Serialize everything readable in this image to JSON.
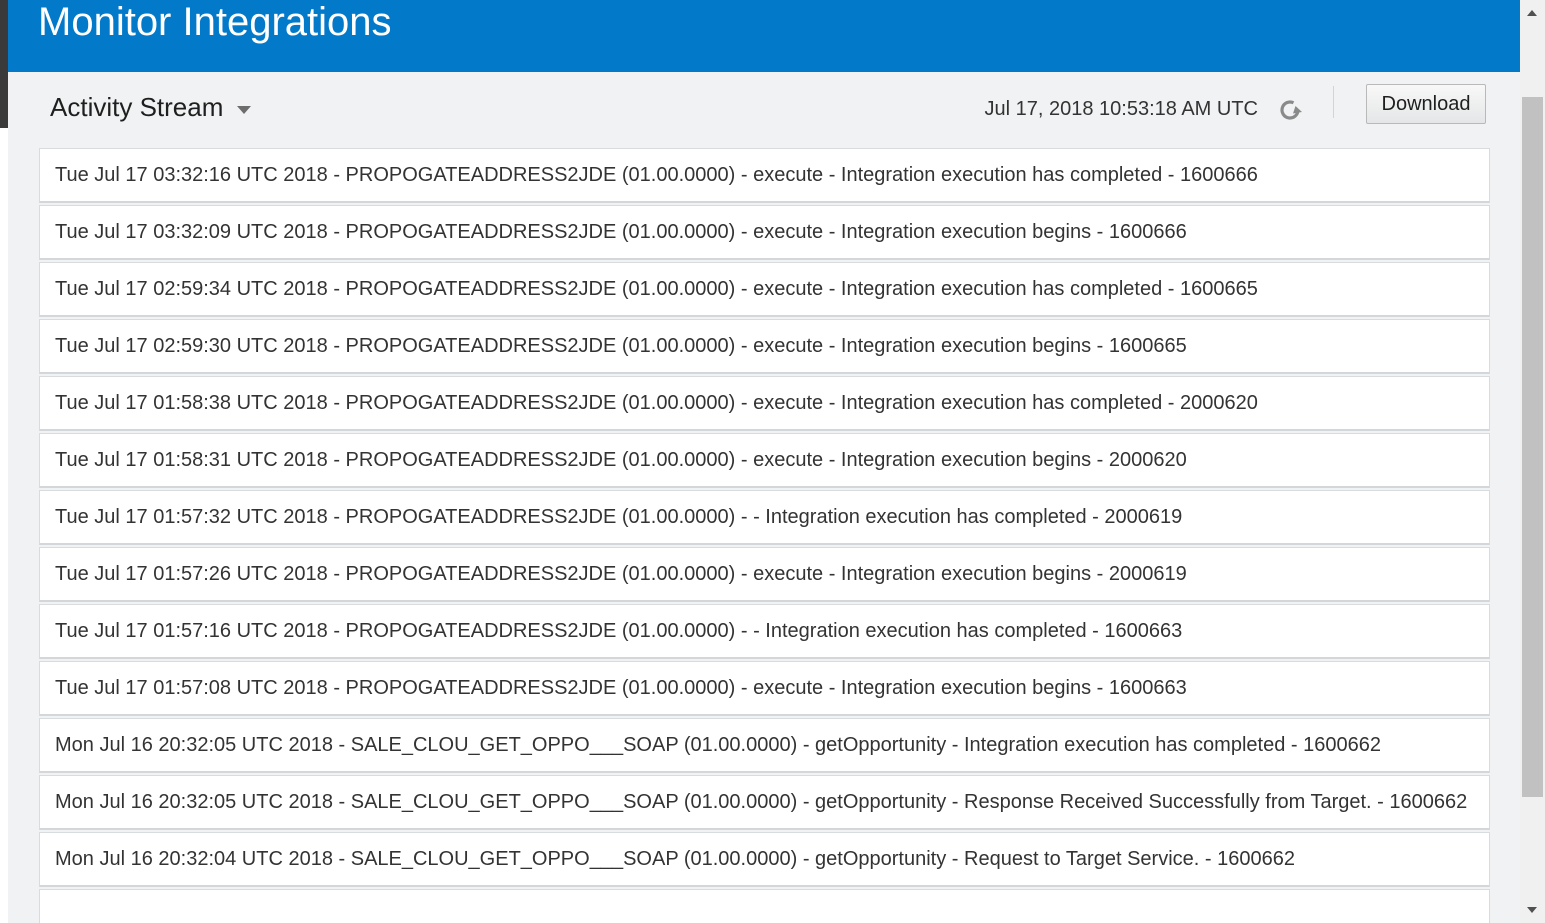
{
  "header": {
    "title": "Monitor Integrations",
    "background_color": "#0279c9"
  },
  "toolbar": {
    "view_label": "Activity Stream",
    "timestamp": "Jul 17, 2018 10:53:18 AM UTC",
    "refresh_icon": "refresh-icon",
    "download_label": "Download"
  },
  "stream": [
    "Tue Jul 17 03:32:16 UTC 2018 - PROPOGATEADDRESS2JDE (01.00.0000) - execute - Integration execution has completed - 1600666",
    "Tue Jul 17 03:32:09 UTC 2018 - PROPOGATEADDRESS2JDE (01.00.0000) - execute - Integration execution begins - 1600666",
    "Tue Jul 17 02:59:34 UTC 2018 - PROPOGATEADDRESS2JDE (01.00.0000) - execute - Integration execution has completed - 1600665",
    "Tue Jul 17 02:59:30 UTC 2018 - PROPOGATEADDRESS2JDE (01.00.0000) - execute - Integration execution begins - 1600665",
    "Tue Jul 17 01:58:38 UTC 2018 - PROPOGATEADDRESS2JDE (01.00.0000) - execute - Integration execution has completed - 2000620",
    "Tue Jul 17 01:58:31 UTC 2018 - PROPOGATEADDRESS2JDE (01.00.0000) - execute - Integration execution begins - 2000620",
    "Tue Jul 17 01:57:32 UTC 2018 - PROPOGATEADDRESS2JDE (01.00.0000) - - Integration execution has completed - 2000619",
    "Tue Jul 17 01:57:26 UTC 2018 - PROPOGATEADDRESS2JDE (01.00.0000) - execute - Integration execution begins - 2000619",
    "Tue Jul 17 01:57:16 UTC 2018 - PROPOGATEADDRESS2JDE (01.00.0000) - - Integration execution has completed - 1600663",
    "Tue Jul 17 01:57:08 UTC 2018 - PROPOGATEADDRESS2JDE (01.00.0000) - execute - Integration execution begins - 1600663",
    "Mon Jul 16 20:32:05 UTC 2018 - SALE_CLOU_GET_OPPO___SOAP (01.00.0000) - getOpportunity - Integration execution has completed - 1600662",
    "Mon Jul 16 20:32:05 UTC 2018 - SALE_CLOU_GET_OPPO___SOAP (01.00.0000) - getOpportunity - Response Received Successfully from Target. - 1600662",
    "Mon Jul 16 20:32:04 UTC 2018 - SALE_CLOU_GET_OPPO___SOAP (01.00.0000) - getOpportunity - Request to Target Service. - 1600662",
    ""
  ]
}
